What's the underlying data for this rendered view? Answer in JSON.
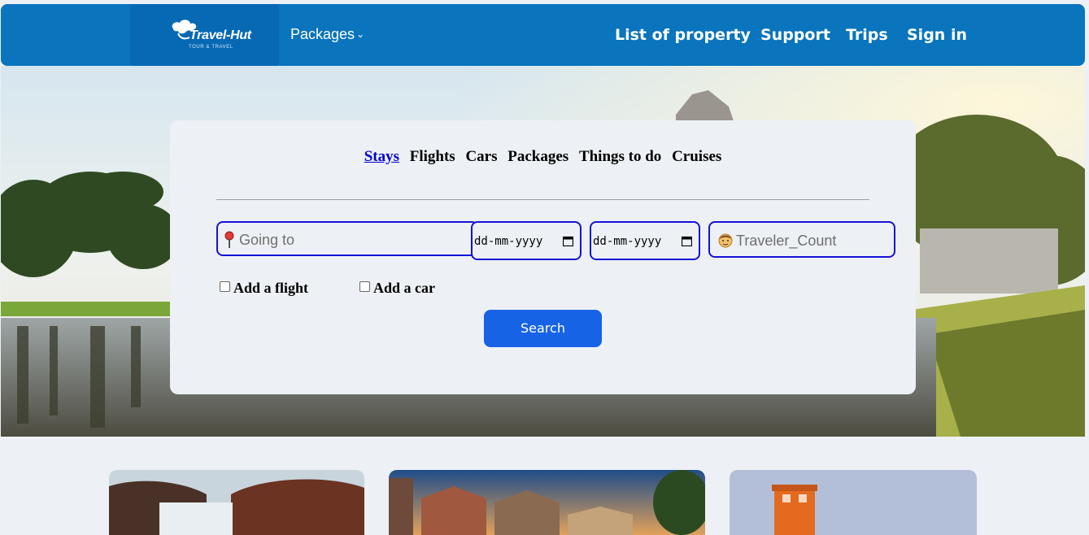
{
  "header": {
    "logo_text": "Travel-Hut",
    "logo_tagline": "TOUR & TRAVEL",
    "packages_label": "Packages",
    "nav_items": [
      {
        "label": "List of property"
      },
      {
        "label": "Support"
      },
      {
        "label": "Trips"
      },
      {
        "label": "Sign in"
      }
    ]
  },
  "search": {
    "tabs": [
      {
        "label": "Stays",
        "active": true
      },
      {
        "label": "Flights"
      },
      {
        "label": "Cars"
      },
      {
        "label": "Packages"
      },
      {
        "label": "Things to do"
      },
      {
        "label": "Cruises"
      }
    ],
    "going_placeholder": "Going to",
    "checkin_placeholder": "dd-mm-yyyy",
    "checkout_placeholder": "dd-mm-yyyy",
    "traveler_placeholder": "Traveler_Count",
    "add_flight_label": "Add a flight",
    "add_car_label": "Add a car",
    "search_button": "Search"
  },
  "colors": {
    "nav_bg": "#0a74bd",
    "field_border": "#1611d6",
    "button_bg": "#1763e6",
    "active_tab": "#0000cc"
  }
}
